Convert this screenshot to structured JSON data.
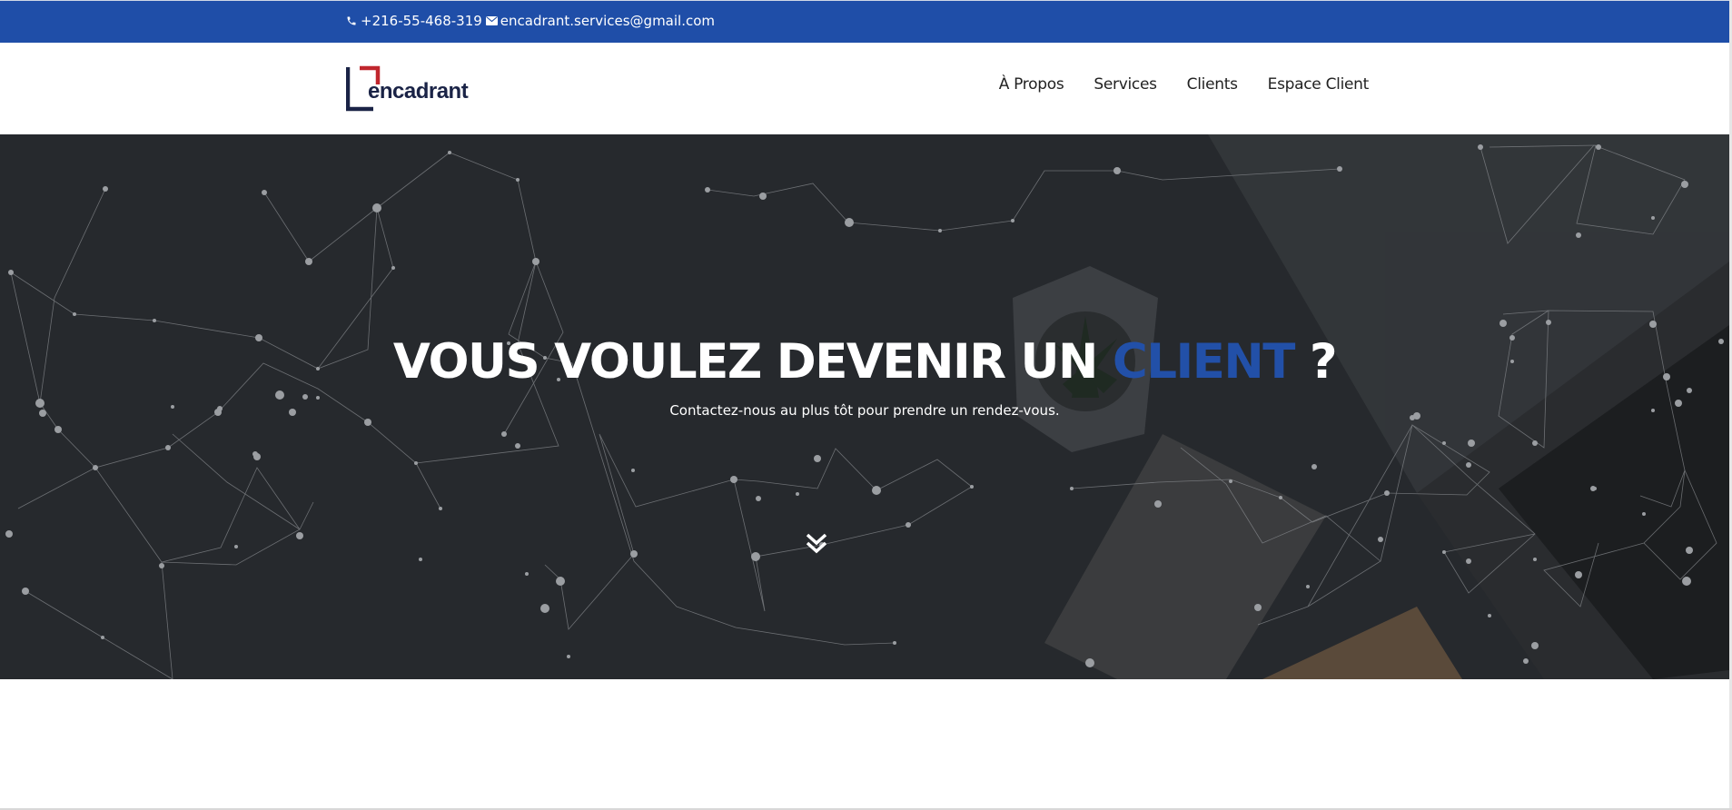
{
  "topbar": {
    "phone": "+216-55-468-319",
    "email": "encadrant.services@gmail.com",
    "phone_icon": "phone-icon",
    "email_icon": "envelope-icon",
    "background_color": "#1f4ea8"
  },
  "header": {
    "logo_text": "encadrant",
    "nav": [
      {
        "label": "À Propos"
      },
      {
        "label": "Services"
      },
      {
        "label": "Clients"
      },
      {
        "label": "Espace Client"
      }
    ]
  },
  "hero": {
    "title_main": "VOUS VOULEZ DEVENIR UN ",
    "title_accent": "CLIENT",
    "title_end": " ?",
    "subtitle": "Contactez-nous au plus tôt pour prendre un rendez-vous.",
    "scroll_icon": "double-chevron-down-icon",
    "accent_color": "#2250a8",
    "background_color": "#26292d"
  }
}
